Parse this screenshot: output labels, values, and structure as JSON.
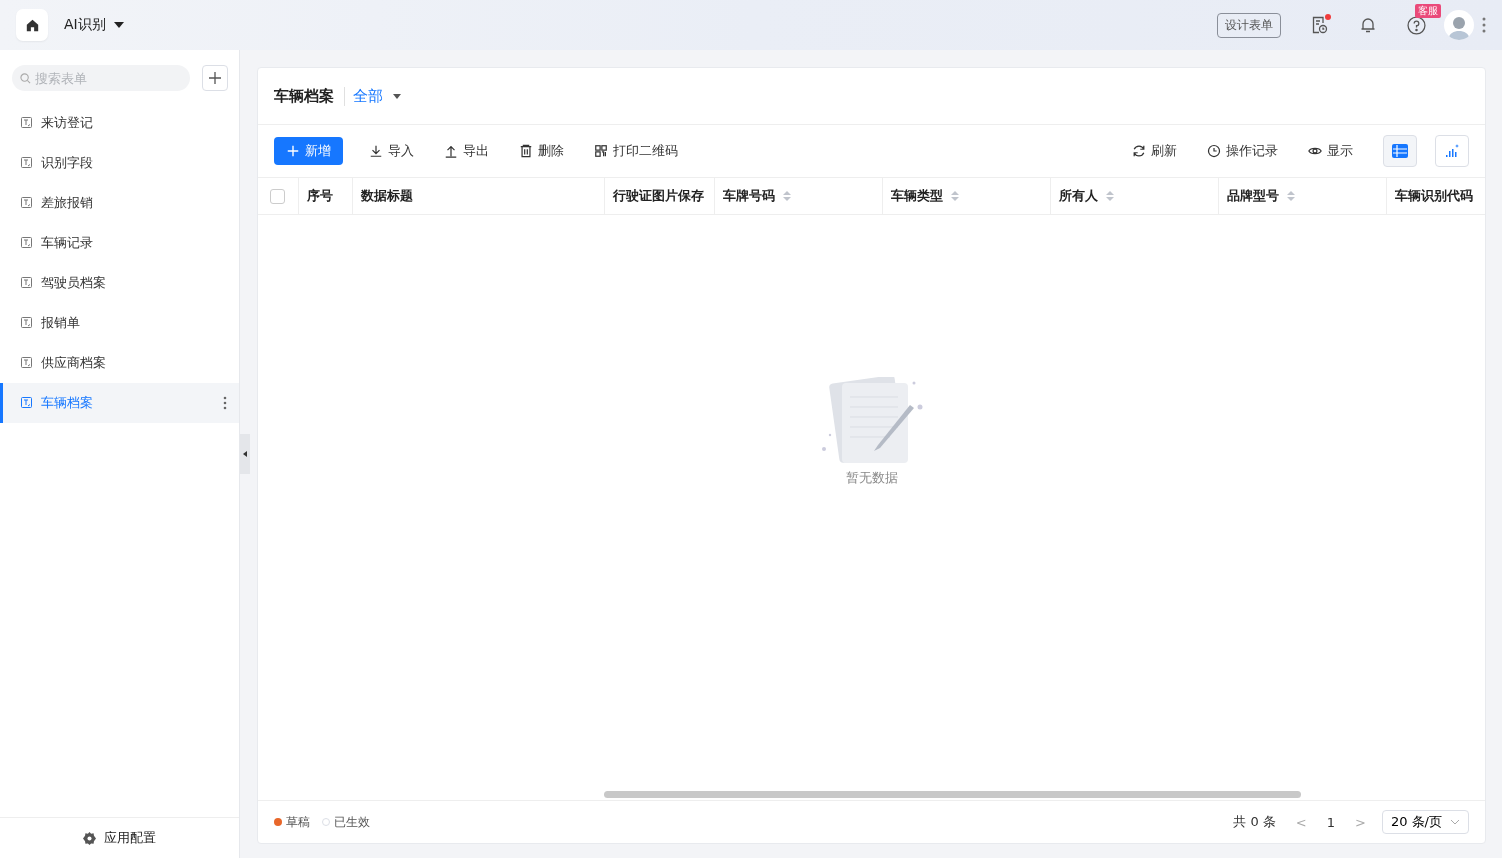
{
  "topbar": {
    "app_name": "AI识别",
    "design_button": "设计表单",
    "help_badge": "客服",
    "has_notice_dot": true
  },
  "sidebar": {
    "search": {
      "placeholder": "搜索表单"
    },
    "items": [
      {
        "label": "来访登记",
        "selected": false
      },
      {
        "label": "识别字段",
        "selected": false
      },
      {
        "label": "差旅报销",
        "selected": false
      },
      {
        "label": "车辆记录",
        "selected": false
      },
      {
        "label": "驾驶员档案",
        "selected": false
      },
      {
        "label": "报销单",
        "selected": false
      },
      {
        "label": "供应商档案",
        "selected": false
      },
      {
        "label": "车辆档案",
        "selected": true
      }
    ],
    "footer": "应用配置"
  },
  "page": {
    "title": "车辆档案",
    "filter": "全部"
  },
  "toolbar": {
    "left": [
      {
        "kind": "add",
        "label": "新增"
      },
      {
        "kind": "import",
        "label": "导入"
      },
      {
        "kind": "export",
        "label": "导出"
      },
      {
        "kind": "delete",
        "label": "删除"
      },
      {
        "kind": "qr",
        "label": "打印二维码"
      }
    ],
    "right": [
      {
        "kind": "refresh",
        "label": "刷新"
      },
      {
        "kind": "history",
        "label": "操作记录"
      },
      {
        "kind": "view",
        "label": "显示"
      }
    ],
    "views": [
      {
        "kind": "table",
        "selected": true
      },
      {
        "kind": "chart",
        "selected": false
      }
    ]
  },
  "table": {
    "select_all_checked": false,
    "columns": [
      {
        "label": "序号",
        "sortable": false
      },
      {
        "label": "数据标题",
        "sortable": false
      },
      {
        "label": "行驶证图片保存",
        "sortable": false
      },
      {
        "label": "车牌号码",
        "sortable": true
      },
      {
        "label": "车辆类型",
        "sortable": true
      },
      {
        "label": "所有人",
        "sortable": true
      },
      {
        "label": "品牌型号",
        "sortable": true
      },
      {
        "label": "车辆识别代码",
        "sortable": false
      }
    ],
    "empty_text": "暂无数据"
  },
  "legend": [
    {
      "label": "草稿",
      "color": "#e8672a",
      "filled": true
    },
    {
      "label": "已生效",
      "color": "#dcdfe6",
      "filled": false
    }
  ],
  "pagination": {
    "total": "共 0 条",
    "prev": "<",
    "page": "1",
    "next": ">",
    "page_size": "20 条/页"
  }
}
